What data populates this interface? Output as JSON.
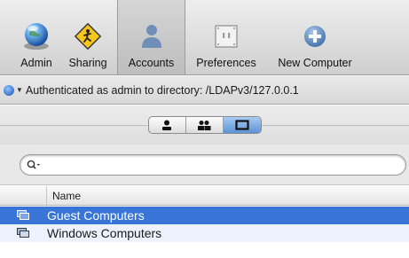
{
  "toolbar": {
    "items": [
      {
        "label": "Admin",
        "icon": "globe-icon"
      },
      {
        "label": "Sharing",
        "icon": "sharing-sign-icon"
      },
      {
        "label": "Accounts",
        "icon": "person-icon"
      },
      {
        "label": "Preferences",
        "icon": "preferences-switch-icon"
      },
      {
        "label": "New Computer",
        "icon": "plus-circle-icon"
      }
    ],
    "selected": "Accounts"
  },
  "status": {
    "text": "Authenticated as admin to directory: /LDAPv3/127.0.0.1"
  },
  "account_type_segments": [
    {
      "icon": "user-icon",
      "active": false
    },
    {
      "icon": "group-icon",
      "active": false
    },
    {
      "icon": "computer-list-icon",
      "active": true
    }
  ],
  "search": {
    "value": "",
    "placeholder": ""
  },
  "list": {
    "column_header": "Name",
    "rows": [
      {
        "label": "Guest Computers",
        "selected": true
      },
      {
        "label": "Windows Computers",
        "selected": false
      }
    ]
  },
  "colors": {
    "selection": "#3875d7",
    "alt_row": "#edf3fe"
  }
}
